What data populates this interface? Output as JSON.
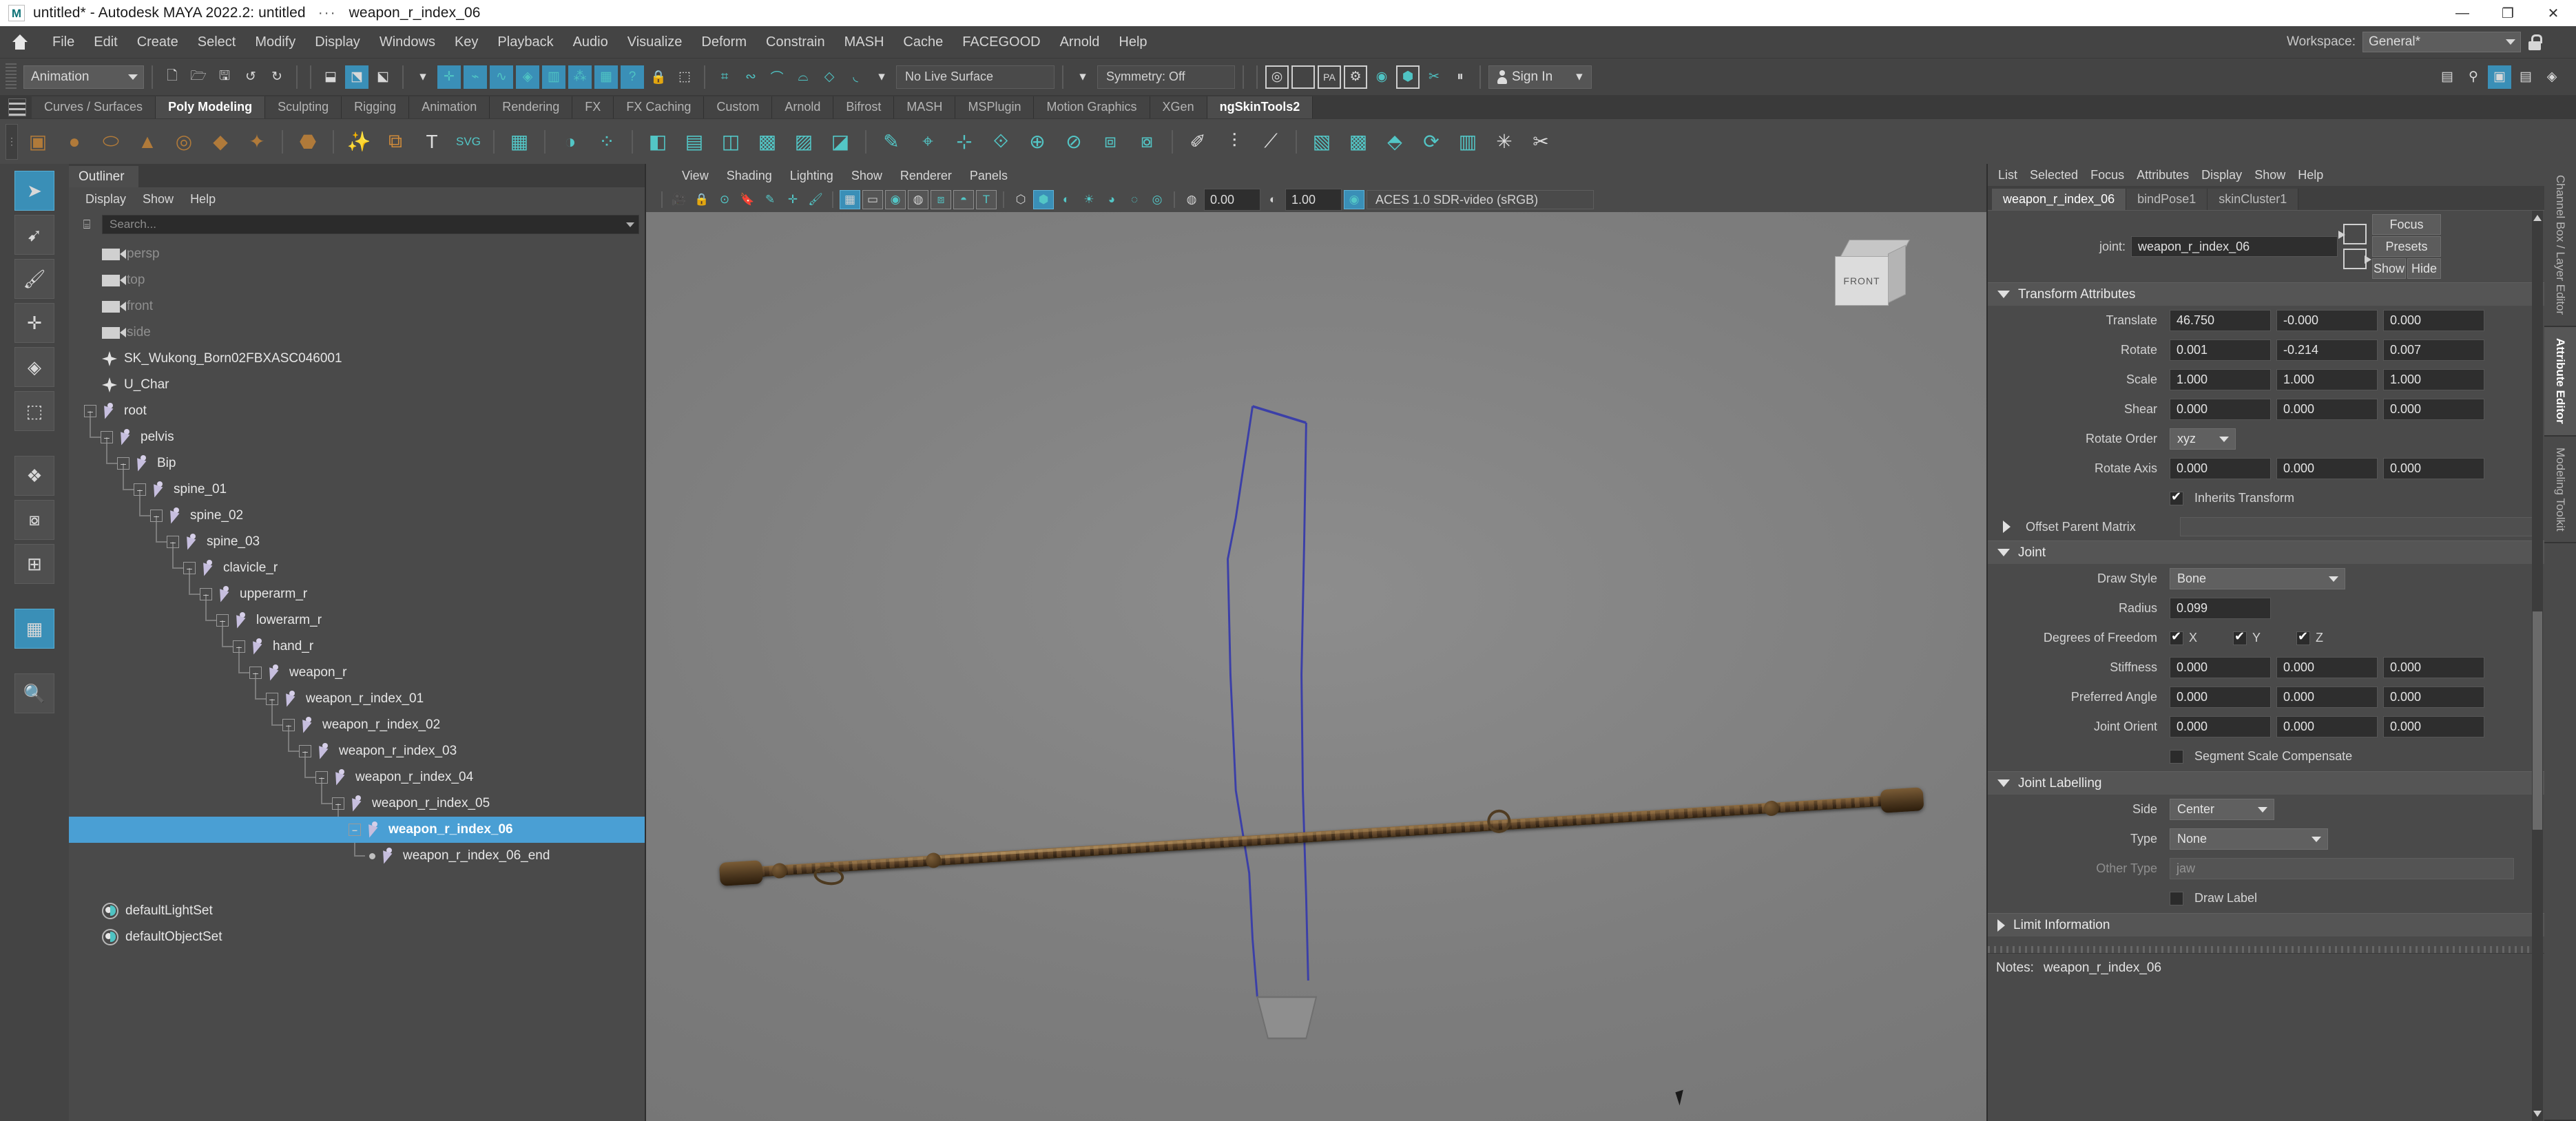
{
  "window": {
    "title": "untitled* - Autodesk MAYA 2022.2: untitled",
    "dots": "···",
    "subject": "weapon_r_index_06",
    "logo": "M",
    "minimize": "—",
    "maximize": "❐",
    "close": "✕"
  },
  "menubar": {
    "items": [
      "File",
      "Edit",
      "Create",
      "Select",
      "Modify",
      "Display",
      "Windows",
      "Key",
      "Playback",
      "Audio",
      "Visualize",
      "Deform",
      "Constrain",
      "MASH",
      "Cache",
      "FACEGOOD",
      "Arnold",
      "Help"
    ],
    "workspace_label": "Workspace:",
    "workspace_value": "General*"
  },
  "statusline": {
    "mode": "Animation",
    "live_surface": "No Live Surface",
    "symmetry": "Symmetry: Off",
    "sign_in": "Sign In",
    "icons_left": [
      "new-scene-icon",
      "open-scene-icon",
      "save-scene-icon",
      "undo-icon",
      "redo-icon"
    ],
    "select_mode_icons": [
      "select-hierarchy-icon",
      "select-object-icon",
      "select-component-icon"
    ],
    "snap_icons": [
      "snap-grid-icon",
      "snap-curve-icon",
      "snap-point-icon",
      "snap-projected-icon",
      "snap-viewplane-icon",
      "snap-uv-icon",
      "snap-texture-icon",
      "help-icon"
    ],
    "lock_icons": [
      "lock-icon",
      "render-select-icon"
    ],
    "magnet_icons": [
      "magnet-grid-icon",
      "magnet-curve-icon",
      "magnet-point-icon",
      "magnet-plane-icon",
      "magnet-uv-icon",
      "magnet-arc-icon"
    ],
    "render_icons": [
      "render-current-frame-icon",
      "ipr-render-icon",
      "render-settings-icon",
      "hypershade-icon",
      "render-view-icon",
      "render-sequence-icon",
      "arnold-render-icon",
      "pause-icon"
    ],
    "panel_icons": [
      "show-hide-ui-icon",
      "character-icon",
      "toggle-sidebar-icon",
      "channel-box-icon",
      "layer-editor-icon"
    ]
  },
  "shelf": {
    "tabs": [
      "Curves / Surfaces",
      "Poly Modeling",
      "Sculpting",
      "Rigging",
      "Animation",
      "Rendering",
      "FX",
      "FX Caching",
      "Custom",
      "Arnold",
      "Bifrost",
      "MASH",
      "MSPlugin",
      "Motion Graphics",
      "XGen",
      "ngSkinTools2"
    ],
    "active_tab": "Poly Modeling",
    "icons": [
      "cube-icon",
      "sphere-icon",
      "cylinder-icon",
      "cone-icon",
      "torus-icon",
      "plane-icon",
      "prism-icon",
      "pyramid-icon",
      "soccer-ball-icon",
      "platonic-icon",
      "sparkle-icon",
      "combine-icon",
      "text-icon",
      "svg-icon",
      "grid-icon",
      "mirror-icon",
      "snap-together-icon",
      "booleans-icon",
      "extrude-icon",
      "bevel-icon",
      "bridge-icon",
      "append-icon",
      "wedge-icon",
      "offset-icon",
      "multicut-icon",
      "target-weld-icon",
      "connect-icon",
      "crease-icon",
      "poke-icon",
      "chamfer-icon",
      "quad-draw-icon",
      "sculpt-icon",
      "smooth-icon",
      "triangulate-icon",
      "reduce-icon",
      "remesh-icon",
      "retopo-icon",
      "unfold-icon",
      "cleanup-icon"
    ]
  },
  "toolbox": {
    "items": [
      "select-tool",
      "lasso-tool",
      "paint-select-tool",
      "move-tool",
      "rotate-tool",
      "scale-tool",
      "last-tool",
      "snap-align-icon",
      "center-pivot-icon",
      "grid-layout-icon",
      "magnify-icon"
    ]
  },
  "outliner": {
    "panel_title": "Outliner",
    "menus": [
      "Display",
      "Show",
      "Help"
    ],
    "search_placeholder": "Search...",
    "items": [
      {
        "label": "persp",
        "type": "camera",
        "indent": 0,
        "expandable": false,
        "state": "dim"
      },
      {
        "label": "top",
        "type": "camera",
        "indent": 0,
        "expandable": false,
        "state": "dim"
      },
      {
        "label": "front",
        "type": "camera",
        "indent": 0,
        "expandable": false,
        "state": "dim"
      },
      {
        "label": "side",
        "type": "camera",
        "indent": 0,
        "expandable": false,
        "state": "dim"
      },
      {
        "label": "SK_Wukong_Born02FBXASC046001",
        "type": "mesh",
        "indent": 0,
        "expandable": false,
        "state": "bright"
      },
      {
        "label": "U_Char",
        "type": "mesh",
        "indent": 0,
        "expandable": false,
        "state": "bright"
      },
      {
        "label": "root",
        "type": "joint",
        "indent": 0,
        "expandable": true,
        "state": "bright"
      },
      {
        "label": "pelvis",
        "type": "joint",
        "indent": 1,
        "expandable": true,
        "state": "bright"
      },
      {
        "label": "Bip",
        "type": "joint",
        "indent": 2,
        "expandable": true,
        "state": "bright"
      },
      {
        "label": "spine_01",
        "type": "joint",
        "indent": 3,
        "expandable": true,
        "state": "bright"
      },
      {
        "label": "spine_02",
        "type": "joint",
        "indent": 4,
        "expandable": true,
        "state": "bright"
      },
      {
        "label": "spine_03",
        "type": "joint",
        "indent": 5,
        "expandable": true,
        "state": "bright"
      },
      {
        "label": "clavicle_r",
        "type": "joint",
        "indent": 6,
        "expandable": true,
        "state": "bright"
      },
      {
        "label": "upperarm_r",
        "type": "joint",
        "indent": 7,
        "expandable": true,
        "state": "bright"
      },
      {
        "label": "lowerarm_r",
        "type": "joint",
        "indent": 8,
        "expandable": true,
        "state": "bright"
      },
      {
        "label": "hand_r",
        "type": "joint",
        "indent": 9,
        "expandable": true,
        "state": "bright"
      },
      {
        "label": "weapon_r",
        "type": "joint",
        "indent": 10,
        "expandable": true,
        "state": "bright"
      },
      {
        "label": "weapon_r_index_01",
        "type": "joint",
        "indent": 11,
        "expandable": true,
        "state": "bright"
      },
      {
        "label": "weapon_r_index_02",
        "type": "joint",
        "indent": 12,
        "expandable": true,
        "state": "bright"
      },
      {
        "label": "weapon_r_index_03",
        "type": "joint",
        "indent": 13,
        "expandable": true,
        "state": "bright"
      },
      {
        "label": "weapon_r_index_04",
        "type": "joint",
        "indent": 14,
        "expandable": true,
        "state": "bright"
      },
      {
        "label": "weapon_r_index_05",
        "type": "joint",
        "indent": 15,
        "expandable": true,
        "state": "bright"
      },
      {
        "label": "weapon_r_index_06",
        "type": "joint",
        "indent": 16,
        "expandable": true,
        "state": "selected"
      },
      {
        "label": "weapon_r_index_06_end",
        "type": "joint",
        "indent": 17,
        "expandable": false,
        "state": "bright"
      },
      {
        "label": "defaultLightSet",
        "type": "set",
        "indent": 0,
        "expandable": false,
        "state": "bright"
      },
      {
        "label": "defaultObjectSet",
        "type": "set",
        "indent": 0,
        "expandable": false,
        "state": "bright"
      }
    ]
  },
  "viewport": {
    "menus": [
      "View",
      "Shading",
      "Lighting",
      "Show",
      "Renderer",
      "Panels"
    ],
    "gamma": "0.00",
    "exposure": "1.00",
    "color_space": "ACES 1.0 SDR-video (sRGB)",
    "view_cube_face": "FRONT",
    "toolbar_icons": [
      "camera-icon",
      "camera-lock-icon",
      "camera-attr-icon",
      "bookmark-icon",
      "paint-effects-icon",
      "xray-joints-icon",
      "brush-icon",
      "grid-toggle-icon",
      "film-gate-icon",
      "resolution-gate-icon",
      "gate-mask-icon",
      "wireframe-on-shaded-icon",
      "smooth-shade-icon",
      "texture-icon",
      "wireframe-icon",
      "shaded-icon",
      "shadows-icon"
    ]
  },
  "attribute_editor": {
    "menus": [
      "List",
      "Selected",
      "Focus",
      "Attributes",
      "Display",
      "Show",
      "Help"
    ],
    "tabs": [
      "weapon_r_index_06",
      "bindPose1",
      "skinCluster1"
    ],
    "active_tab": "weapon_r_index_06",
    "node_label": "joint:",
    "node_name": "weapon_r_index_06",
    "buttons": {
      "focus": "Focus",
      "presets": "Presets",
      "show": "Show",
      "hide": "Hide"
    },
    "transform_attributes": {
      "title": "Transform Attributes",
      "translate": {
        "label": "Translate",
        "x": "46.750",
        "y": "-0.000",
        "z": "0.000"
      },
      "rotate": {
        "label": "Rotate",
        "x": "0.001",
        "y": "-0.214",
        "z": "0.007"
      },
      "scale": {
        "label": "Scale",
        "x": "1.000",
        "y": "1.000",
        "z": "1.000"
      },
      "shear": {
        "label": "Shear",
        "x": "0.000",
        "y": "0.000",
        "z": "0.000"
      },
      "rotate_order": {
        "label": "Rotate Order",
        "value": "xyz"
      },
      "rotate_axis": {
        "label": "Rotate Axis",
        "x": "0.000",
        "y": "0.000",
        "z": "0.000"
      },
      "inherits_transform": {
        "label": "Inherits Transform",
        "checked": true
      }
    },
    "offset_parent_matrix": {
      "title": "Offset Parent Matrix"
    },
    "joint": {
      "title": "Joint",
      "draw_style": {
        "label": "Draw Style",
        "value": "Bone"
      },
      "radius": {
        "label": "Radius",
        "value": "0.099"
      },
      "degrees_of_freedom": {
        "label": "Degrees of Freedom",
        "x": "X",
        "y": "Y",
        "z": "Z",
        "x_checked": true,
        "y_checked": true,
        "z_checked": true
      },
      "stiffness": {
        "label": "Stiffness",
        "x": "0.000",
        "y": "0.000",
        "z": "0.000"
      },
      "preferred_angle": {
        "label": "Preferred Angle",
        "x": "0.000",
        "y": "0.000",
        "z": "0.000"
      },
      "joint_orient": {
        "label": "Joint Orient",
        "x": "0.000",
        "y": "0.000",
        "z": "0.000"
      },
      "segment_scale_compensate": {
        "label": "Segment Scale Compensate",
        "checked": false
      }
    },
    "joint_labelling": {
      "title": "Joint Labelling",
      "side": {
        "label": "Side",
        "value": "Center"
      },
      "type": {
        "label": "Type",
        "value": "None"
      },
      "other_type": {
        "label": "Other Type",
        "placeholder": "jaw"
      },
      "draw_label": {
        "label": "Draw Label",
        "checked": false
      }
    },
    "limit_information": {
      "title": "Limit Information"
    },
    "notes": {
      "label": "Notes:",
      "value": "weapon_r_index_06"
    }
  },
  "right_tabs": {
    "items": [
      "Channel Box / Layer Editor",
      "Attribute Editor",
      "Modeling Toolkit"
    ],
    "active": "Attribute Editor"
  },
  "colors": {
    "accent_blue": "#4a9fd4",
    "teal": "#4fc3c3",
    "panel_bg": "#444444",
    "viewport_bg": "#7d7d7d",
    "selection": "#4a9fd4"
  }
}
